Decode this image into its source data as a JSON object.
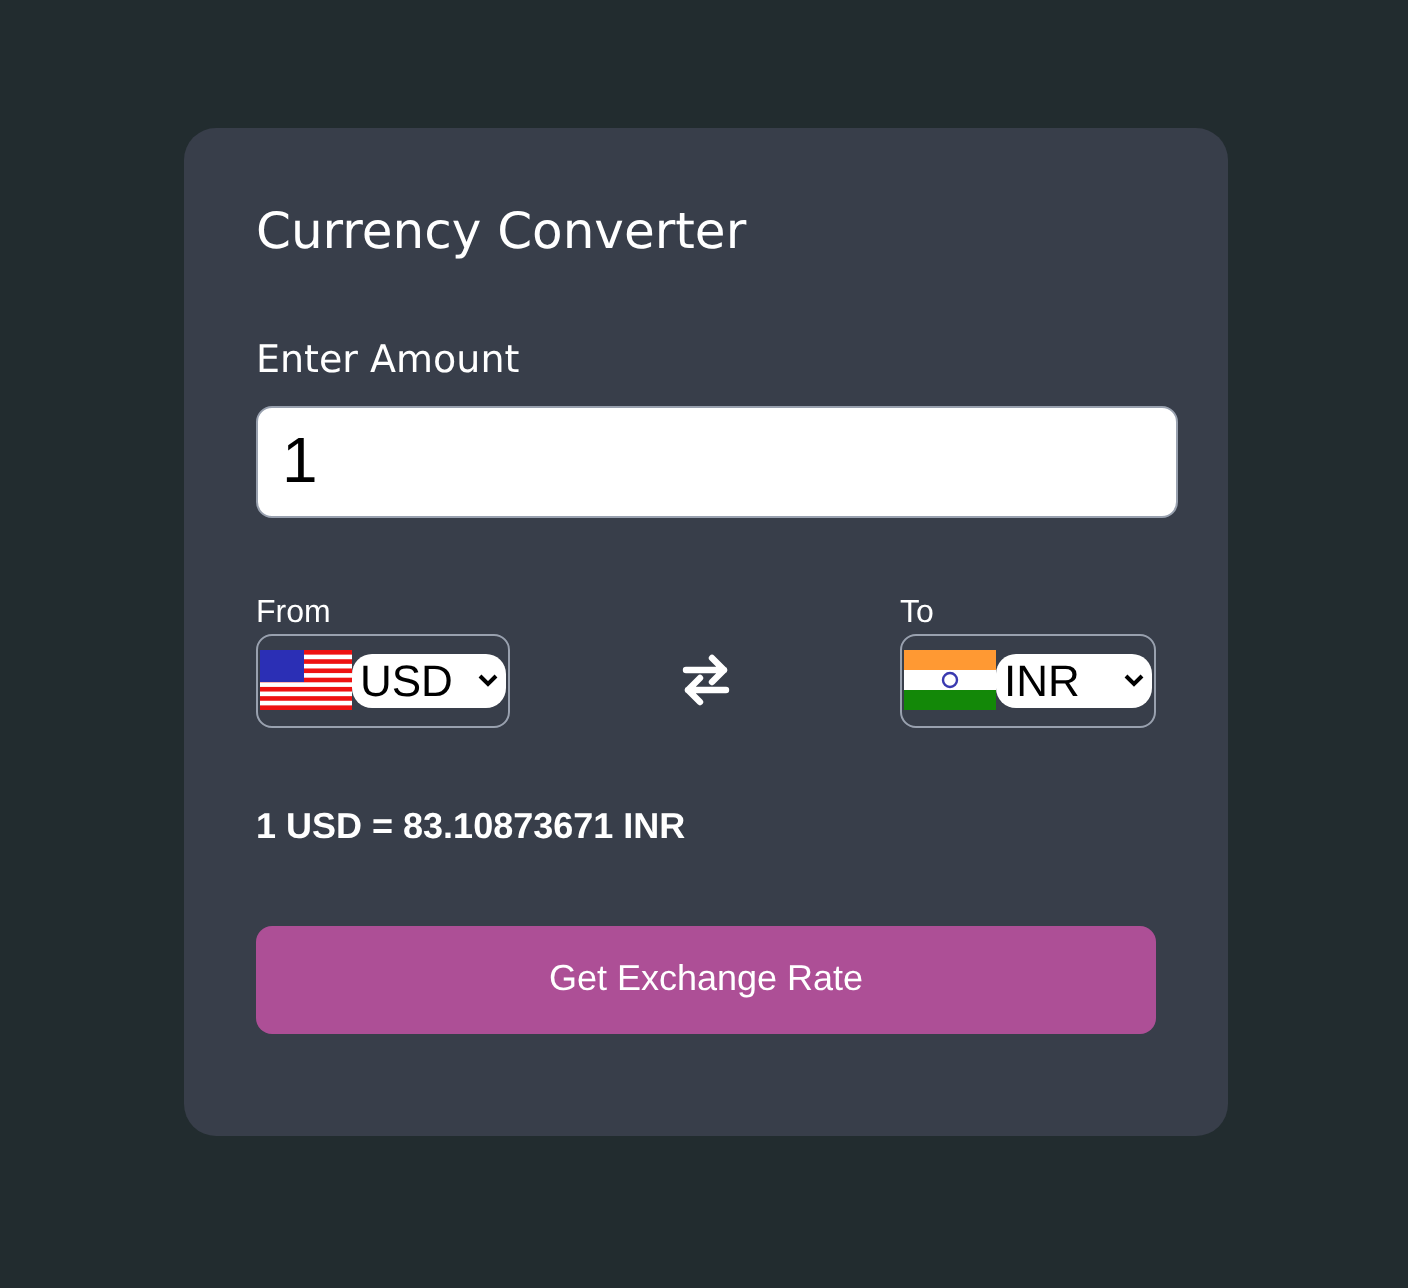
{
  "title": "Currency Converter",
  "amount": {
    "label": "Enter Amount",
    "value": "1"
  },
  "from": {
    "label": "From",
    "currency": "USD",
    "kind": "us"
  },
  "to": {
    "label": "To",
    "currency": "INR",
    "kind": "in"
  },
  "result": "1 USD = 83.10873671 INR",
  "button": "Get Exchange Rate"
}
